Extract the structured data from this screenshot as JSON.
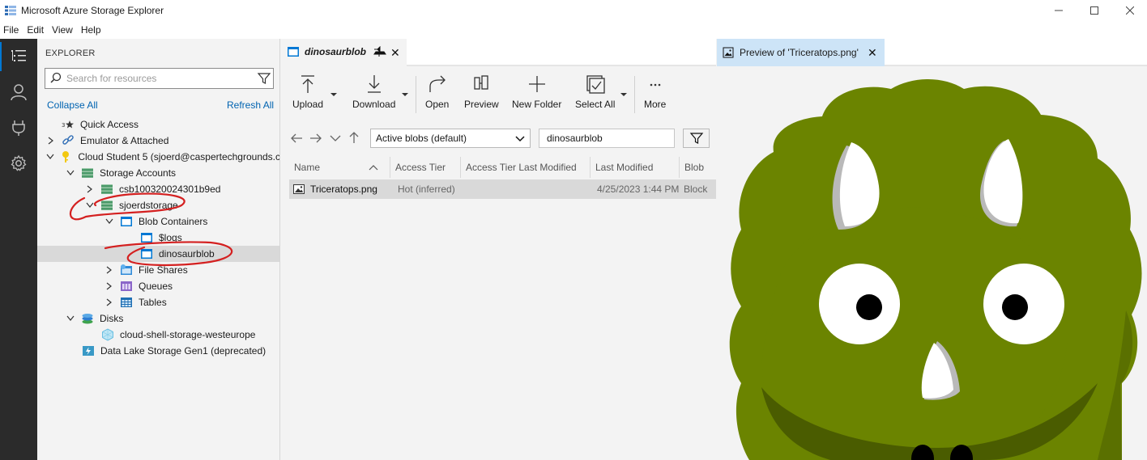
{
  "window": {
    "title": "Microsoft Azure Storage Explorer",
    "controls": [
      "minimize",
      "maximize",
      "close"
    ]
  },
  "menu": [
    "File",
    "Edit",
    "View",
    "Help"
  ],
  "activity_bar": [
    {
      "icon": "explorer-icon",
      "active": true
    },
    {
      "icon": "account-icon"
    },
    {
      "icon": "plug-icon"
    },
    {
      "icon": "settings-icon"
    }
  ],
  "explorer": {
    "header": "EXPLORER",
    "search_placeholder": "Search for resources",
    "collapse_all": "Collapse All",
    "refresh_all": "Refresh All",
    "tree": {
      "quick_access": "Quick Access",
      "emulator": "Emulator & Attached",
      "subscription": "Cloud Student 5 (sjoerd@caspertechgrounds.c",
      "storage_accounts": "Storage Accounts",
      "account1": "csb100320024301b9ed",
      "account2": "sjoerdstorage",
      "blob_containers": "Blob Containers",
      "container1": "$logs",
      "container2": "dinosaurblob",
      "file_shares": "File Shares",
      "queues": "Queues",
      "tables": "Tables",
      "disks": "Disks",
      "disk1": "cloud-shell-storage-westeurope",
      "datalake": "Data Lake Storage Gen1 (deprecated)"
    },
    "annotation_color": "#d42020"
  },
  "center": {
    "tab_label": "dinosaurblob",
    "toolbar": {
      "upload": "Upload",
      "download": "Download",
      "open": "Open",
      "preview": "Preview",
      "new_folder": "New Folder",
      "select_all": "Select All",
      "more": "More"
    },
    "view_filter": "Active blobs (default)",
    "path": "dinosaurblob",
    "columns": [
      "Name",
      "Access Tier",
      "Access Tier Last Modified",
      "Last Modified",
      "Blob"
    ],
    "rows": [
      {
        "name": "Triceratops.png",
        "access_tier": "Hot (inferred)",
        "tier_modified": "",
        "last_modified": "4/25/2023 1:44 PM",
        "blob_type": "Block"
      }
    ]
  },
  "preview": {
    "tab_label": "Preview of 'Triceratops.png'",
    "colors": {
      "skin": "#6b8400",
      "dark": "#4a5c00",
      "horn": "#ffffff",
      "horn_shade": "#b9b9b9",
      "eye_pupil": "#000000"
    }
  },
  "accent": "#0078d4"
}
